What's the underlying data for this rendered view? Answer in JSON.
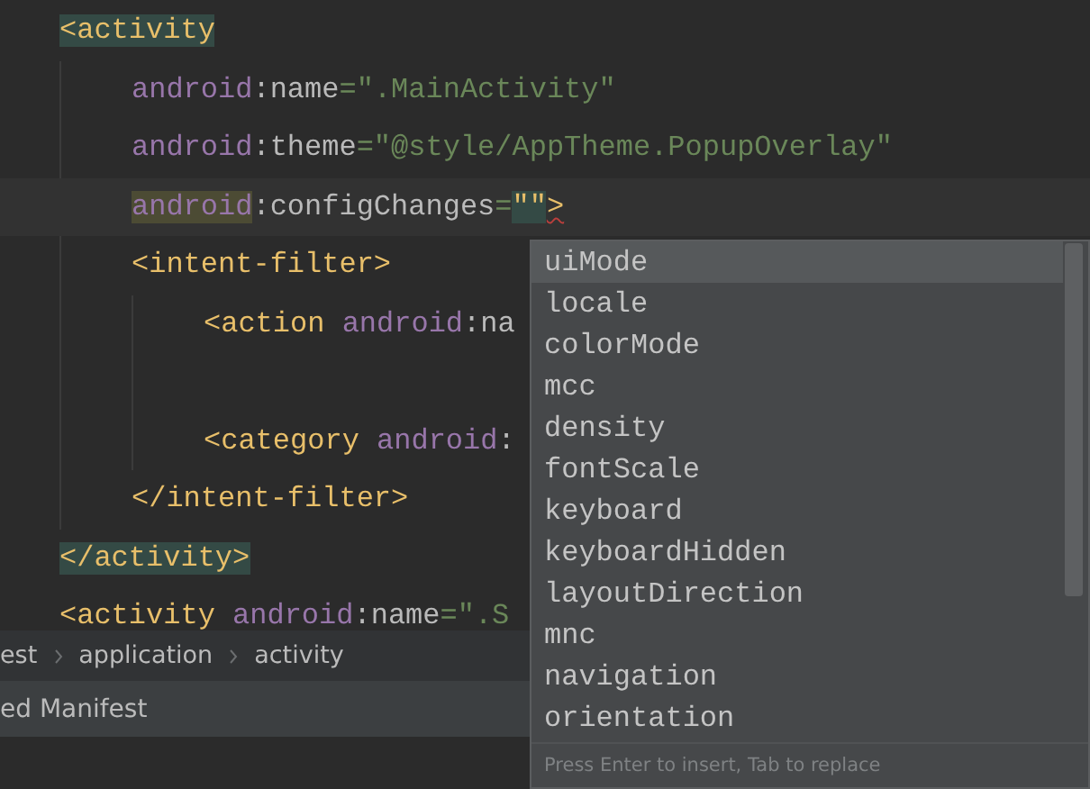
{
  "editor": {
    "lines": [
      {
        "tokens": [
          {
            "kind": "tag_match",
            "text": "<activity"
          }
        ],
        "children": [
          {
            "tokens": [
              {
                "kind": "ns",
                "text": "android"
              },
              {
                "kind": "plain",
                "text": ":name"
              },
              {
                "kind": "str",
                "text": "=\".MainActivity\""
              }
            ]
          },
          {
            "tokens": [
              {
                "kind": "ns",
                "text": "android"
              },
              {
                "kind": "plain",
                "text": ":theme"
              },
              {
                "kind": "str",
                "text": "=\"@style/AppTheme.PopupOverlay\""
              }
            ]
          },
          {
            "current": true,
            "tokens": [
              {
                "kind": "ns_usage",
                "text": "android"
              },
              {
                "kind": "plain",
                "text": ":configChanges"
              },
              {
                "kind": "str",
                "text": "="
              },
              {
                "kind": "quote_match",
                "text": "\"\""
              },
              {
                "kind": "tag_error",
                "text": ">"
              }
            ]
          },
          {
            "tokens": [
              {
                "kind": "tag",
                "text": "<intent-filter>"
              }
            ],
            "children": [
              {
                "tokens": [
                  {
                    "kind": "tag",
                    "text": "<action "
                  },
                  {
                    "kind": "ns",
                    "text": "android"
                  },
                  {
                    "kind": "plain",
                    "text": ":na"
                  }
                ]
              },
              {
                "kind": "blank"
              },
              {
                "tokens": [
                  {
                    "kind": "tag",
                    "text": "<category "
                  },
                  {
                    "kind": "ns",
                    "text": "android"
                  },
                  {
                    "kind": "plain",
                    "text": ":"
                  }
                ]
              }
            ]
          },
          {
            "tokens": [
              {
                "kind": "tag",
                "text": "</intent-filter>"
              }
            ]
          }
        ]
      },
      {
        "tokens": [
          {
            "kind": "tag_match",
            "text": "</activity>"
          }
        ]
      },
      {
        "tokens": [
          {
            "kind": "tag",
            "text": "<activity "
          },
          {
            "kind": "ns",
            "text": "android"
          },
          {
            "kind": "plain",
            "text": ":name"
          },
          {
            "kind": "str",
            "text": "=\".S"
          }
        ]
      }
    ]
  },
  "breadcrumb": [
    "est",
    "application",
    "activity"
  ],
  "tool_tab": "ed Manifest",
  "completion": {
    "items": [
      {
        "label": "uiMode",
        "selected": true
      },
      {
        "label": "locale",
        "selected": false
      },
      {
        "label": "colorMode",
        "selected": false
      },
      {
        "label": "mcc",
        "selected": false
      },
      {
        "label": "density",
        "selected": false
      },
      {
        "label": "fontScale",
        "selected": false
      },
      {
        "label": "keyboard",
        "selected": false
      },
      {
        "label": "keyboardHidden",
        "selected": false
      },
      {
        "label": "layoutDirection",
        "selected": false
      },
      {
        "label": "mnc",
        "selected": false
      },
      {
        "label": "navigation",
        "selected": false
      },
      {
        "label": "orientation",
        "selected": false
      }
    ],
    "hint": "Press Enter to insert, Tab to replace"
  }
}
